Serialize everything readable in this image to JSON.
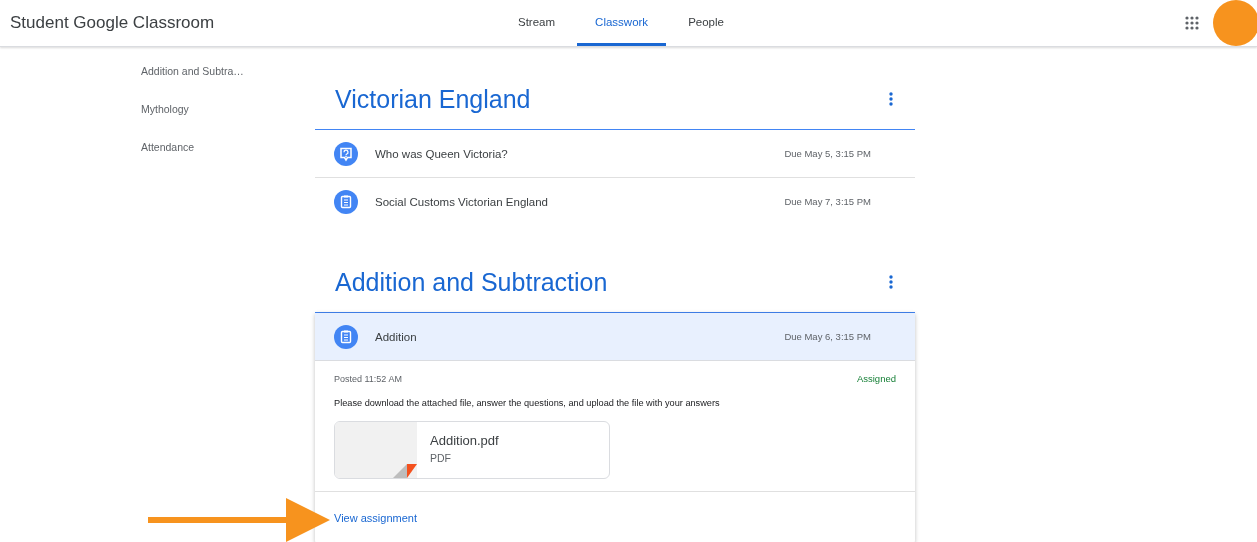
{
  "header": {
    "title": "Student Google Classroom",
    "tabs": [
      {
        "label": "Stream",
        "selected": false
      },
      {
        "label": "Classwork",
        "selected": true
      },
      {
        "label": "People",
        "selected": false
      }
    ]
  },
  "sidebar": {
    "items": [
      "Addition and Subtra…",
      "Mythology",
      "Attendance"
    ]
  },
  "topics": [
    {
      "title": "Victorian England",
      "items": [
        {
          "kind": "question",
          "title": "Who was Queen Victoria?",
          "due": "Due May 5, 3:15 PM",
          "expanded": false
        },
        {
          "kind": "assignment",
          "title": "Social Customs Victorian England",
          "due": "Due May 7, 3:15 PM",
          "expanded": false
        }
      ]
    },
    {
      "title": "Addition and Subtraction",
      "items": [
        {
          "kind": "assignment",
          "title": "Addition",
          "due": "Due May 6, 3:15 PM",
          "expanded": true,
          "posted": "Posted 11:52 AM",
          "status": "Assigned",
          "instructions": "Please download the attached file, answer the questions, and upload the file with your answers",
          "attachment": {
            "name": "Addition.pdf",
            "type": "PDF"
          },
          "link": "View assignment"
        }
      ]
    }
  ]
}
